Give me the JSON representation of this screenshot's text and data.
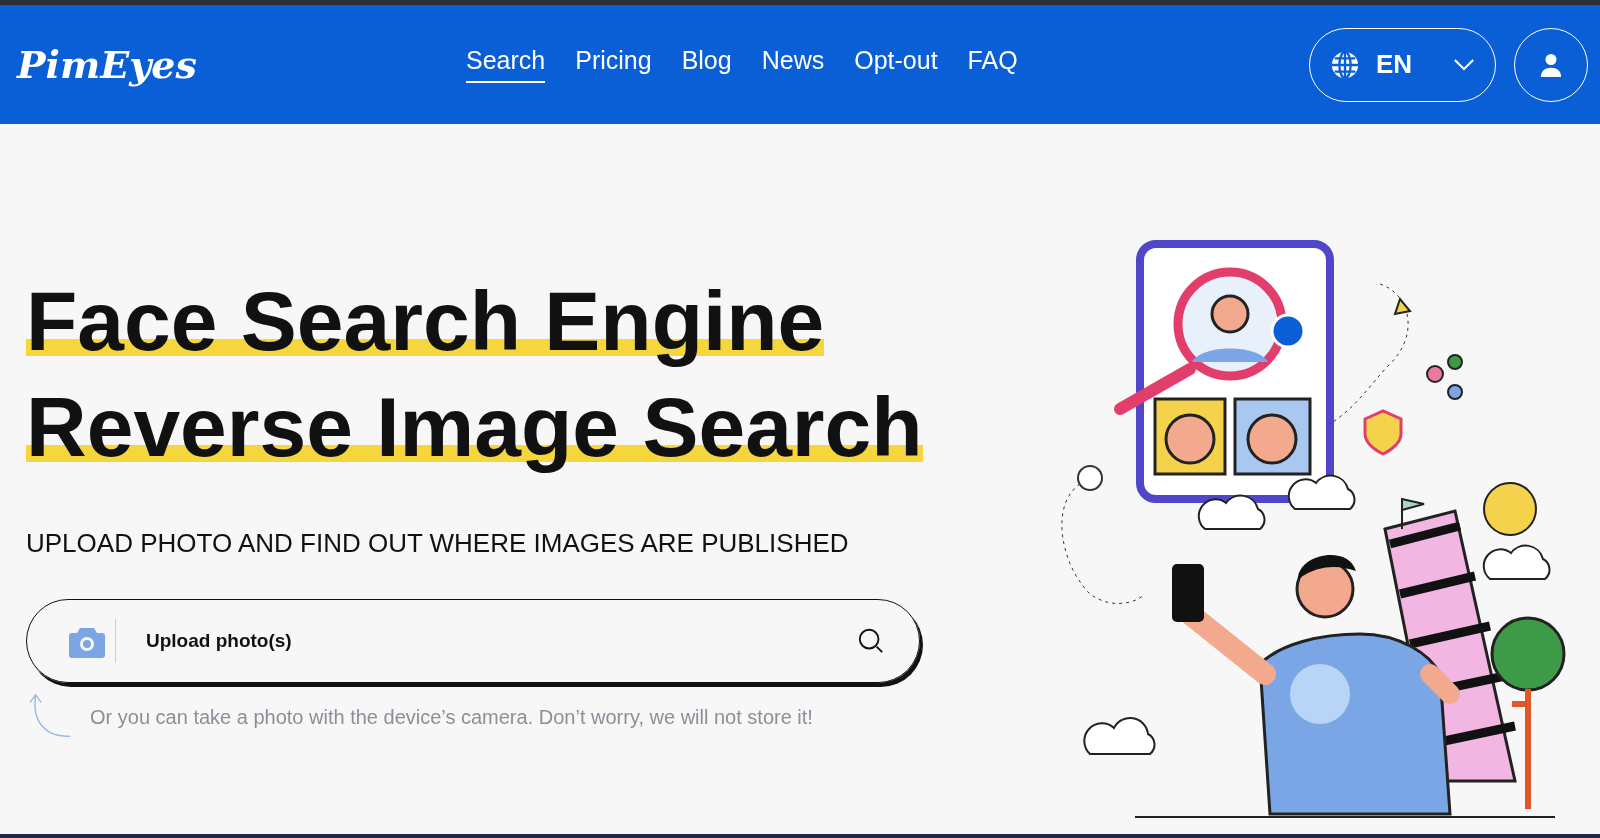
{
  "header": {
    "logo": "PimEyes",
    "nav": [
      {
        "label": "Search",
        "selected": true
      },
      {
        "label": "Pricing",
        "selected": false
      },
      {
        "label": "Blog",
        "selected": false
      },
      {
        "label": "News",
        "selected": false
      },
      {
        "label": "Opt-out",
        "selected": false
      },
      {
        "label": "FAQ",
        "selected": false
      }
    ],
    "language": {
      "label": "EN"
    }
  },
  "hero": {
    "title_lines": [
      "Face Search Engine",
      "Reverse Image Search"
    ],
    "subtitle": "UPLOAD PHOTO AND FIND OUT WHERE IMAGES ARE PUBLISHED",
    "upload": {
      "label": "Upload photo(s)"
    },
    "hint": "Or you can take a photo with the device’s camera. Don’t worry, we will not store it!"
  }
}
